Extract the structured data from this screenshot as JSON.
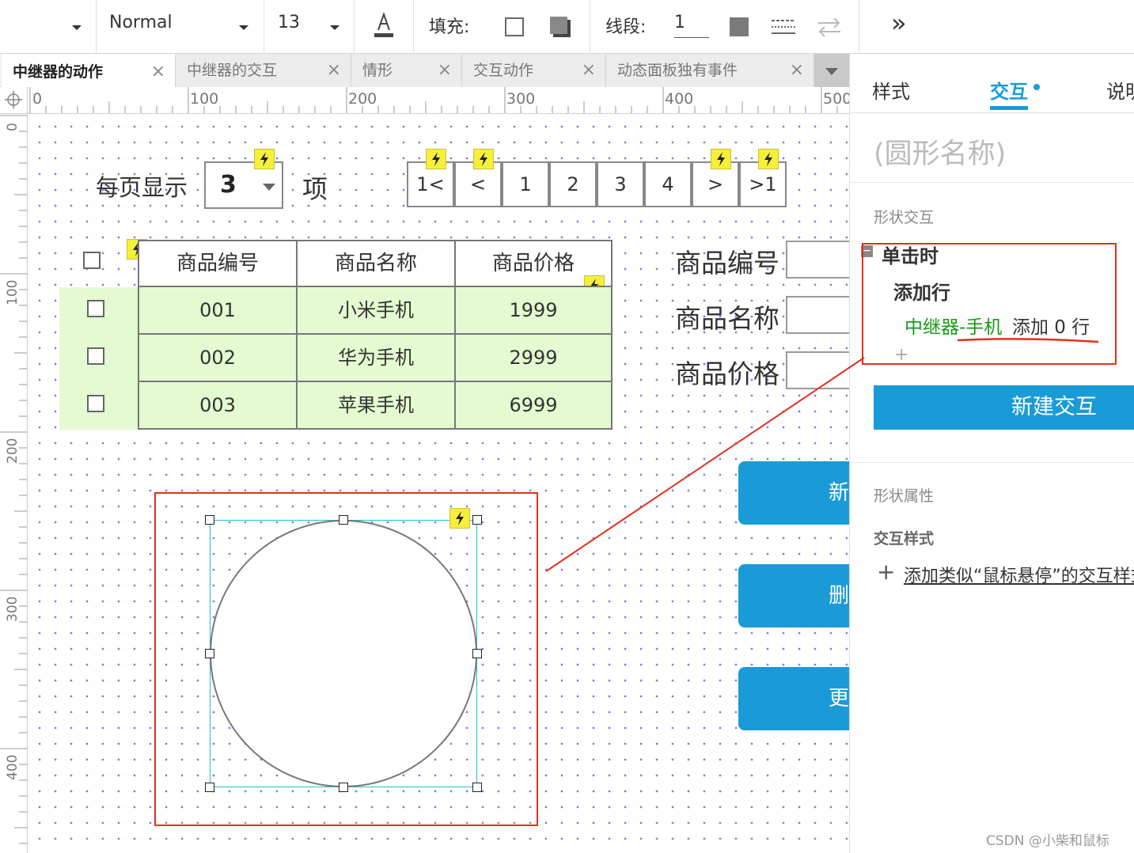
{
  "toolbar": {
    "font_style": "Normal",
    "font_size": "13",
    "fill_label": "填充:",
    "stroke_label": "线段:",
    "stroke_width": "1",
    "more_glyph": "»"
  },
  "tabs": [
    {
      "label": "中继器的动作",
      "active": true
    },
    {
      "label": "中继器的交互",
      "active": false
    },
    {
      "label": "情形",
      "active": false
    },
    {
      "label": "交互动作",
      "active": false
    },
    {
      "label": "动态面板独有事件",
      "active": false
    }
  ],
  "ruler": {
    "top": [
      "0",
      "100",
      "200",
      "300",
      "400",
      "500"
    ],
    "left": [
      "0",
      "100",
      "200",
      "300",
      "400"
    ]
  },
  "canvas": {
    "per_page_label": "每页显示",
    "per_page_value": "3",
    "items_label": "项",
    "pager": [
      "1<",
      "<",
      "1",
      "2",
      "3",
      "4",
      ">",
      ">1"
    ],
    "table": {
      "headers": [
        "商品编号",
        "商品名称",
        "商品价格"
      ],
      "rows": [
        [
          "001",
          "小米手机",
          "1999"
        ],
        [
          "002",
          "华为手机",
          "2999"
        ],
        [
          "003",
          "苹果手机",
          "6999"
        ]
      ]
    },
    "form": {
      "labels": [
        "商品编号",
        "商品名称",
        "商品价格"
      ]
    },
    "side_buttons": [
      "新",
      "删",
      "更"
    ]
  },
  "panel": {
    "tabs": [
      "样式",
      "交互",
      "说明"
    ],
    "active_tab": "交互",
    "shape_name_placeholder": "(圆形名称)",
    "shape_interactions_label": "形状交互",
    "event": "单击时",
    "action": "添加行",
    "target": "中继器-手机",
    "action_detail": "添加 0 行",
    "add_glyph": "+",
    "new_interaction_button": "新建交互",
    "shape_properties_label": "形状属性",
    "interaction_style_label": "交互样式",
    "add_style_link": "添加类似“鼠标悬停”的交互样式",
    "watermark": "CSDN @小柴和鼠标"
  },
  "colors": {
    "accent": "#1a9bd7",
    "row_fill": "#e4fbd1",
    "lightning": "#f5ef3b",
    "annotation_red": "#e5301e",
    "selection_cyan": "#20c0d0",
    "target_green": "#169b16"
  }
}
